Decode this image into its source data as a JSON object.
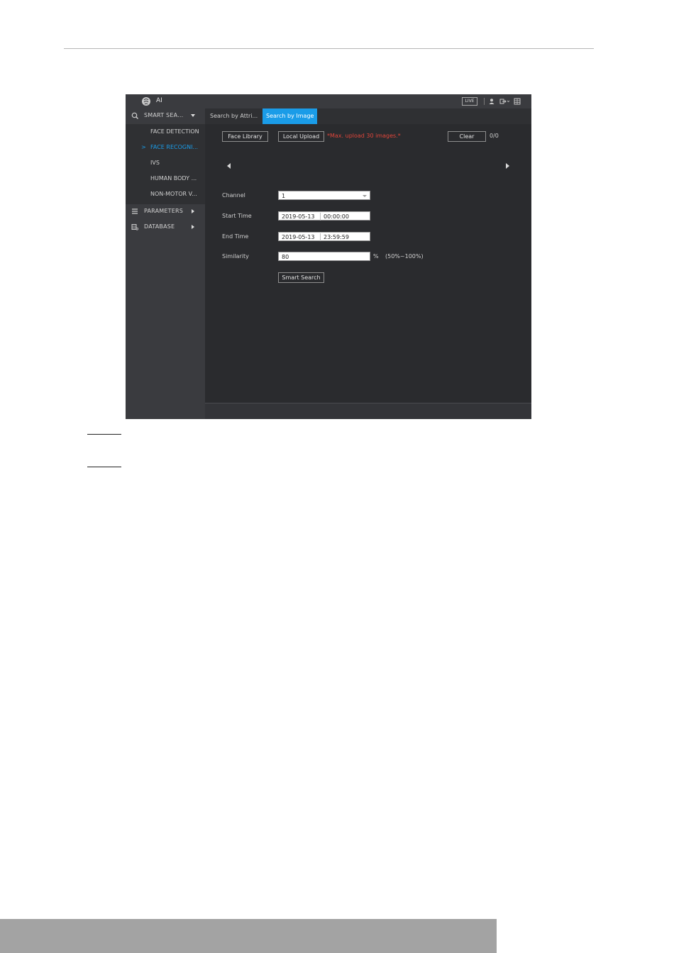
{
  "app": {
    "title": "AI",
    "live_label": "LIVE"
  },
  "sidebar": {
    "groups": [
      {
        "label": "SMART SEA...",
        "icon": "search-icon",
        "expanded": true
      },
      {
        "label": "PARAMETERS",
        "icon": "list-icon"
      },
      {
        "label": "DATABASE",
        "icon": "database-icon"
      }
    ],
    "sub_items": [
      {
        "label": "FACE DETECTION",
        "active": false
      },
      {
        "label": "FACE RECOGNI...",
        "active": true
      },
      {
        "label": "IVS",
        "active": false
      },
      {
        "label": "HUMAN BODY ...",
        "active": false
      },
      {
        "label": "NON-MOTOR V...",
        "active": false
      }
    ],
    "active_marker": ">"
  },
  "tabs": [
    {
      "label": "Search by Attri...",
      "active": false
    },
    {
      "label": "Search by Image",
      "active": true
    }
  ],
  "toolbar": {
    "face_library": "Face Library",
    "local_upload": "Local Upload",
    "warning": "*Max. upload 30 images.*",
    "clear": "Clear",
    "count": "0/0"
  },
  "form": {
    "channel": {
      "label": "Channel",
      "value": "1"
    },
    "start_time": {
      "label": "Start Time",
      "date": "2019-05-13",
      "time": "00:00:00"
    },
    "end_time": {
      "label": "End Time",
      "date": "2019-05-13",
      "time": "23:59:59"
    },
    "similarity": {
      "label": "Similarity",
      "value": "80",
      "unit": "%",
      "range": "(50%~100%)"
    },
    "smart_search": "Smart Search"
  },
  "colors": {
    "accent": "#1a9ce8",
    "warning": "#e0453a",
    "panel": "#2a2b2e",
    "sidebar": "#3a3b3f"
  }
}
